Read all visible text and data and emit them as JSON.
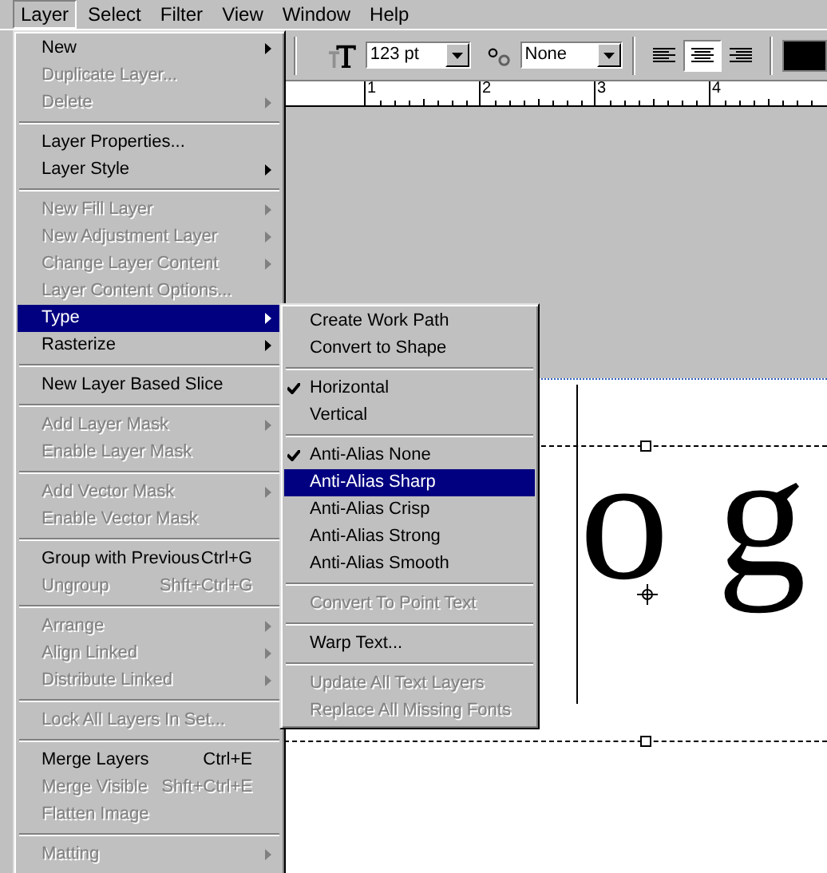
{
  "menu_bar": [
    {
      "label": "Layer",
      "selected": true
    },
    {
      "label": "Select",
      "selected": false
    },
    {
      "label": "Filter",
      "selected": false
    },
    {
      "label": "View",
      "selected": false
    },
    {
      "label": "Window",
      "selected": false
    },
    {
      "label": "Help",
      "selected": false
    }
  ],
  "options_bar": {
    "font_size": "123 pt",
    "anti_alias": "None",
    "alignment": [
      {
        "selected": false
      },
      {
        "selected": true
      },
      {
        "selected": false
      }
    ]
  },
  "ruler": [
    "1",
    "2",
    "3",
    "4"
  ],
  "canvas_text": [
    "o",
    "g"
  ],
  "layer_menu": [
    {
      "kind": "item",
      "label": "New",
      "submenu": true,
      "disabled": false,
      "selected": false
    },
    {
      "kind": "item",
      "label": "Duplicate Layer...",
      "submenu": false,
      "disabled": true,
      "selected": false
    },
    {
      "kind": "item",
      "label": "Delete",
      "submenu": true,
      "disabled": true,
      "selected": false
    },
    {
      "kind": "separator"
    },
    {
      "kind": "item",
      "label": "Layer Properties...",
      "submenu": false,
      "disabled": false,
      "selected": false
    },
    {
      "kind": "item",
      "label": "Layer Style",
      "submenu": true,
      "disabled": false,
      "selected": false
    },
    {
      "kind": "separator"
    },
    {
      "kind": "item",
      "label": "New Fill Layer",
      "submenu": true,
      "disabled": true,
      "selected": false
    },
    {
      "kind": "item",
      "label": "New Adjustment Layer",
      "submenu": true,
      "disabled": true,
      "selected": false
    },
    {
      "kind": "item",
      "label": "Change Layer Content",
      "submenu": true,
      "disabled": true,
      "selected": false
    },
    {
      "kind": "item",
      "label": "Layer Content Options...",
      "submenu": false,
      "disabled": true,
      "selected": false
    },
    {
      "kind": "item",
      "label": "Type",
      "submenu": true,
      "disabled": false,
      "selected": true
    },
    {
      "kind": "item",
      "label": "Rasterize",
      "submenu": true,
      "disabled": false,
      "selected": false
    },
    {
      "kind": "separator"
    },
    {
      "kind": "item",
      "label": "New Layer Based Slice",
      "submenu": false,
      "disabled": false,
      "selected": false
    },
    {
      "kind": "separator"
    },
    {
      "kind": "item",
      "label": "Add Layer Mask",
      "submenu": true,
      "disabled": true,
      "selected": false
    },
    {
      "kind": "item",
      "label": "Enable Layer Mask",
      "submenu": false,
      "disabled": true,
      "selected": false
    },
    {
      "kind": "separator"
    },
    {
      "kind": "item",
      "label": "Add Vector Mask",
      "submenu": true,
      "disabled": true,
      "selected": false
    },
    {
      "kind": "item",
      "label": "Enable Vector Mask",
      "submenu": false,
      "disabled": true,
      "selected": false
    },
    {
      "kind": "separator"
    },
    {
      "kind": "item",
      "label": "Group with Previous",
      "shortcut": "Ctrl+G",
      "submenu": false,
      "disabled": false,
      "selected": false
    },
    {
      "kind": "item",
      "label": "Ungroup",
      "shortcut": "Shft+Ctrl+G",
      "submenu": false,
      "disabled": true,
      "selected": false
    },
    {
      "kind": "separator"
    },
    {
      "kind": "item",
      "label": "Arrange",
      "submenu": true,
      "disabled": true,
      "selected": false
    },
    {
      "kind": "item",
      "label": "Align Linked",
      "submenu": true,
      "disabled": true,
      "selected": false
    },
    {
      "kind": "item",
      "label": "Distribute Linked",
      "submenu": true,
      "disabled": true,
      "selected": false
    },
    {
      "kind": "separator"
    },
    {
      "kind": "item",
      "label": "Lock All Layers In Set...",
      "submenu": false,
      "disabled": true,
      "selected": false
    },
    {
      "kind": "separator"
    },
    {
      "kind": "item",
      "label": "Merge Layers",
      "shortcut": "Ctrl+E",
      "submenu": false,
      "disabled": false,
      "selected": false
    },
    {
      "kind": "item",
      "label": "Merge Visible",
      "shortcut": "Shft+Ctrl+E",
      "submenu": false,
      "disabled": true,
      "selected": false
    },
    {
      "kind": "item",
      "label": "Flatten Image",
      "submenu": false,
      "disabled": true,
      "selected": false
    },
    {
      "kind": "separator"
    },
    {
      "kind": "item",
      "label": "Matting",
      "submenu": true,
      "disabled": true,
      "selected": false
    }
  ],
  "type_submenu": [
    {
      "kind": "item",
      "label": "Create Work Path",
      "checked": false,
      "disabled": false,
      "selected": false
    },
    {
      "kind": "item",
      "label": "Convert to Shape",
      "checked": false,
      "disabled": false,
      "selected": false
    },
    {
      "kind": "separator"
    },
    {
      "kind": "item",
      "label": "Horizontal",
      "checked": true,
      "disabled": false,
      "selected": false
    },
    {
      "kind": "item",
      "label": "Vertical",
      "checked": false,
      "disabled": false,
      "selected": false
    },
    {
      "kind": "separator"
    },
    {
      "kind": "item",
      "label": "Anti-Alias None",
      "checked": true,
      "disabled": false,
      "selected": false
    },
    {
      "kind": "item",
      "label": "Anti-Alias Sharp",
      "checked": false,
      "disabled": false,
      "selected": true
    },
    {
      "kind": "item",
      "label": "Anti-Alias Crisp",
      "checked": false,
      "disabled": false,
      "selected": false
    },
    {
      "kind": "item",
      "label": "Anti-Alias Strong",
      "checked": false,
      "disabled": false,
      "selected": false
    },
    {
      "kind": "item",
      "label": "Anti-Alias Smooth",
      "checked": false,
      "disabled": false,
      "selected": false
    },
    {
      "kind": "separator"
    },
    {
      "kind": "item",
      "label": "Convert To Point Text",
      "checked": false,
      "disabled": true,
      "selected": false
    },
    {
      "kind": "separator"
    },
    {
      "kind": "item",
      "label": "Warp Text...",
      "checked": false,
      "disabled": false,
      "selected": false
    },
    {
      "kind": "separator"
    },
    {
      "kind": "item",
      "label": "Update All Text Layers",
      "checked": false,
      "disabled": true,
      "selected": false
    },
    {
      "kind": "item",
      "label": "Replace All Missing Fonts",
      "checked": false,
      "disabled": true,
      "selected": false
    }
  ]
}
